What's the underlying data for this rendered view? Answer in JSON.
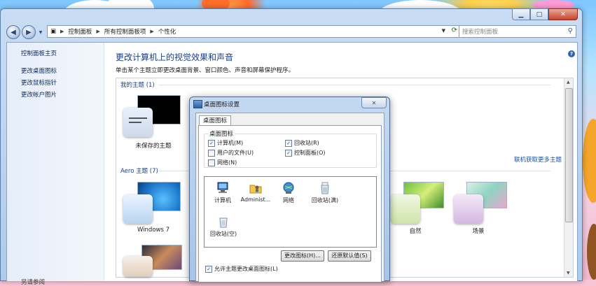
{
  "window": {
    "breadcrumb": [
      "控制面板",
      "所有控制面板项",
      "个性化"
    ],
    "search_placeholder": "搜索控制面板"
  },
  "sidebar": {
    "items": [
      {
        "label": "控制面板主页"
      },
      {
        "label": "更改桌面图标"
      },
      {
        "label": "更改鼠标指针"
      },
      {
        "label": "更改帐户图片"
      },
      {
        "label": "另请参阅"
      }
    ]
  },
  "main": {
    "title": "更改计算机上的视觉效果和声音",
    "subtitle": "单击某个主题立即更改桌面背景、窗口颜色、声音和屏幕保护程序。",
    "my_themes_group": "我的主题 (1)",
    "aero_group": "Aero 主题 (7)",
    "online_link": "联机获取更多主题",
    "themes": [
      {
        "label": "未保存的主题"
      },
      {
        "label": "Windows 7"
      },
      {
        "label": "自然"
      },
      {
        "label": "场景"
      }
    ]
  },
  "dialog": {
    "title": "桌面图标设置",
    "tab": "桌面图标",
    "group": "桌面图标",
    "checkboxes": [
      {
        "label": "计算机(M)",
        "checked": true
      },
      {
        "label": "回收站(R)",
        "checked": true
      },
      {
        "label": "用户的文件(U)",
        "checked": false
      },
      {
        "label": "控制面板(O)",
        "checked": true
      },
      {
        "label": "网络(N)",
        "checked": false
      }
    ],
    "icons": [
      {
        "label": "计算机",
        "icon": "computer-icon"
      },
      {
        "label": "Administ...",
        "icon": "user-folder-icon"
      },
      {
        "label": "网络",
        "icon": "network-icon"
      },
      {
        "label": "回收站(满)",
        "icon": "recycle-bin-full-icon"
      },
      {
        "label": "回收站(空)",
        "icon": "recycle-bin-empty-icon"
      }
    ],
    "change_icon_button": "更改图标(H)...",
    "restore_default_button": "还原默认值(S)",
    "allow_themes_label": "允许主题更改桌面图标(L)",
    "allow_themes_checked": true
  },
  "colors": {
    "link": "#10295a",
    "heading": "#1a3d87"
  }
}
